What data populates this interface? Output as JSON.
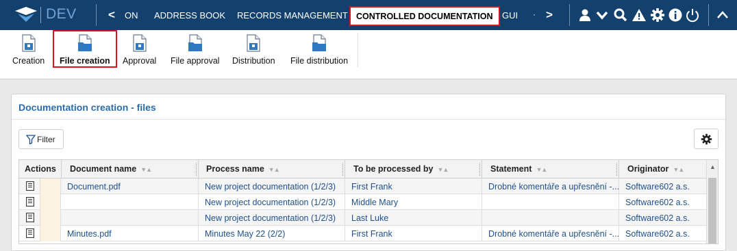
{
  "topbar": {
    "env_label": "DEV",
    "nav_items": [
      {
        "label": "ON"
      },
      {
        "label": "ADDRESS BOOK"
      },
      {
        "label": "RECORDS MANAGEMENT"
      },
      {
        "label": "CONTROLLED DOCUMENTATION"
      },
      {
        "label": "GUI"
      }
    ],
    "prev_arrow": "<",
    "next_arrow": ">",
    "dot": "·",
    "icons": [
      "user-icon",
      "chevron-down-icon",
      "search-icon",
      "warning-icon",
      "gear-icon",
      "info-icon",
      "power-icon",
      "collapse-up-icon"
    ]
  },
  "toolbar": {
    "items": [
      {
        "label": "Creation",
        "icon": "document-icon"
      },
      {
        "label": "File creation",
        "icon": "folder-document-icon"
      },
      {
        "label": "Approval",
        "icon": "document-icon"
      },
      {
        "label": "File approval",
        "icon": "folder-document-icon"
      },
      {
        "label": "Distribution",
        "icon": "document-icon"
      },
      {
        "label": "File distribution",
        "icon": "folder-document-icon"
      }
    ]
  },
  "panel": {
    "title": "Documentation creation - files",
    "filter_label": "Filter"
  },
  "table": {
    "columns": [
      "Actions",
      "Document name",
      "Process name",
      "To be processed by",
      "Statement",
      "Originator"
    ],
    "sort_glyphs": "▼▲",
    "rows": [
      {
        "document": "Document.pdf",
        "process": "New project documentation (1/2/3)",
        "processor": "First Frank",
        "statement": "Drobné komentáře a upřesnění -...",
        "originator": "Software602 a.s."
      },
      {
        "document": "",
        "process": "New project documentation (1/2/3)",
        "processor": "Middle Mary",
        "statement": "",
        "originator": "Software602 a.s."
      },
      {
        "document": "",
        "process": "New project documentation (1/2/3)",
        "processor": "Last Luke",
        "statement": "",
        "originator": "Software602 a.s."
      },
      {
        "document": "Minutes.pdf",
        "process": "Minutes May 22 (2/2)",
        "processor": "First Frank",
        "statement": "Drobné komentáře a upřesnění -...",
        "originator": "Software602 a.s."
      }
    ]
  },
  "colors": {
    "topbar_bg": "#14406e",
    "accent_blue": "#2c6ca8",
    "highlight_red": "#d9141c"
  }
}
